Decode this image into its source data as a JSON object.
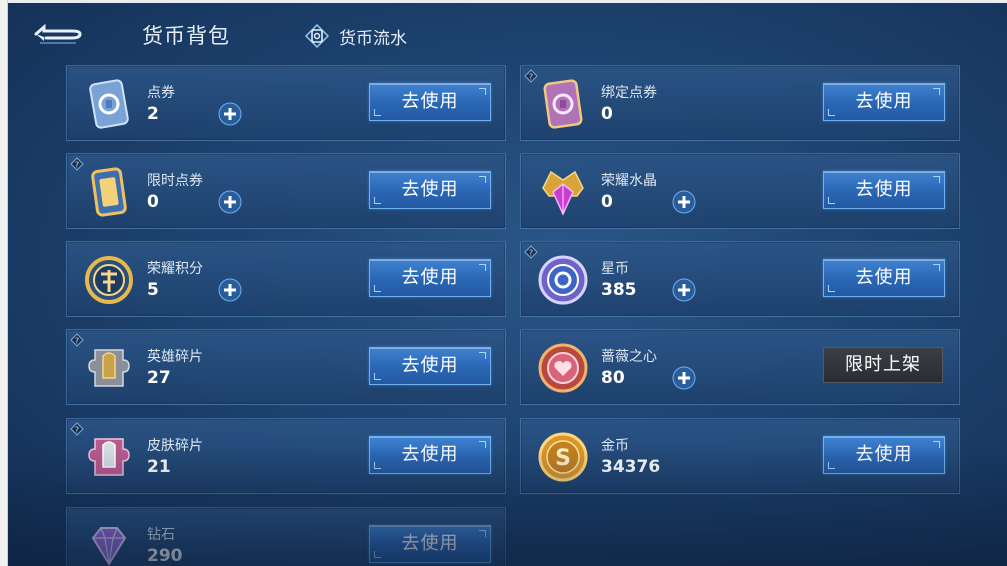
{
  "header": {
    "title": "货币背包",
    "flow_link": "货币流水"
  },
  "currencies": [
    {
      "name": "点券",
      "count": "2",
      "button": "去使用",
      "icon": "voucher-ticket-icon",
      "has_help": false,
      "has_plus": true
    },
    {
      "name": "绑定点券",
      "count": "0",
      "button": "去使用",
      "icon": "bound-voucher-icon",
      "has_help": true,
      "has_plus": false
    },
    {
      "name": "限时点券",
      "count": "0",
      "button": "去使用",
      "icon": "limited-voucher-icon",
      "has_help": true,
      "has_plus": true
    },
    {
      "name": "荣耀水晶",
      "count": "0",
      "button": "去使用",
      "icon": "glory-crystal-icon",
      "has_help": false,
      "has_plus": true
    },
    {
      "name": "荣耀积分",
      "count": "5",
      "button": "去使用",
      "icon": "glory-points-icon",
      "has_help": false,
      "has_plus": true
    },
    {
      "name": "星币",
      "count": "385",
      "button": "去使用",
      "icon": "star-coin-icon",
      "has_help": true,
      "has_plus": true
    },
    {
      "name": "英雄碎片",
      "count": "27",
      "button": "去使用",
      "icon": "hero-fragment-icon",
      "has_help": true,
      "has_plus": false
    },
    {
      "name": "蔷薇之心",
      "count": "80",
      "button": "限时上架",
      "icon": "rose-heart-icon",
      "has_help": false,
      "has_plus": true
    },
    {
      "name": "皮肤碎片",
      "count": "21",
      "button": "去使用",
      "icon": "skin-fragment-icon",
      "has_help": true,
      "has_plus": false
    },
    {
      "name": "金币",
      "count": "34376",
      "button": "去使用",
      "icon": "gold-coin-icon",
      "has_help": false,
      "has_plus": false
    },
    {
      "name": "钻石",
      "count": "290",
      "button": "去使用",
      "icon": "diamond-icon",
      "has_help": false,
      "has_plus": false
    }
  ],
  "colors": {
    "background": "#1d4370",
    "card": "#2c5688",
    "use_button": "#3174c2",
    "limited_button": "#2f3237"
  }
}
